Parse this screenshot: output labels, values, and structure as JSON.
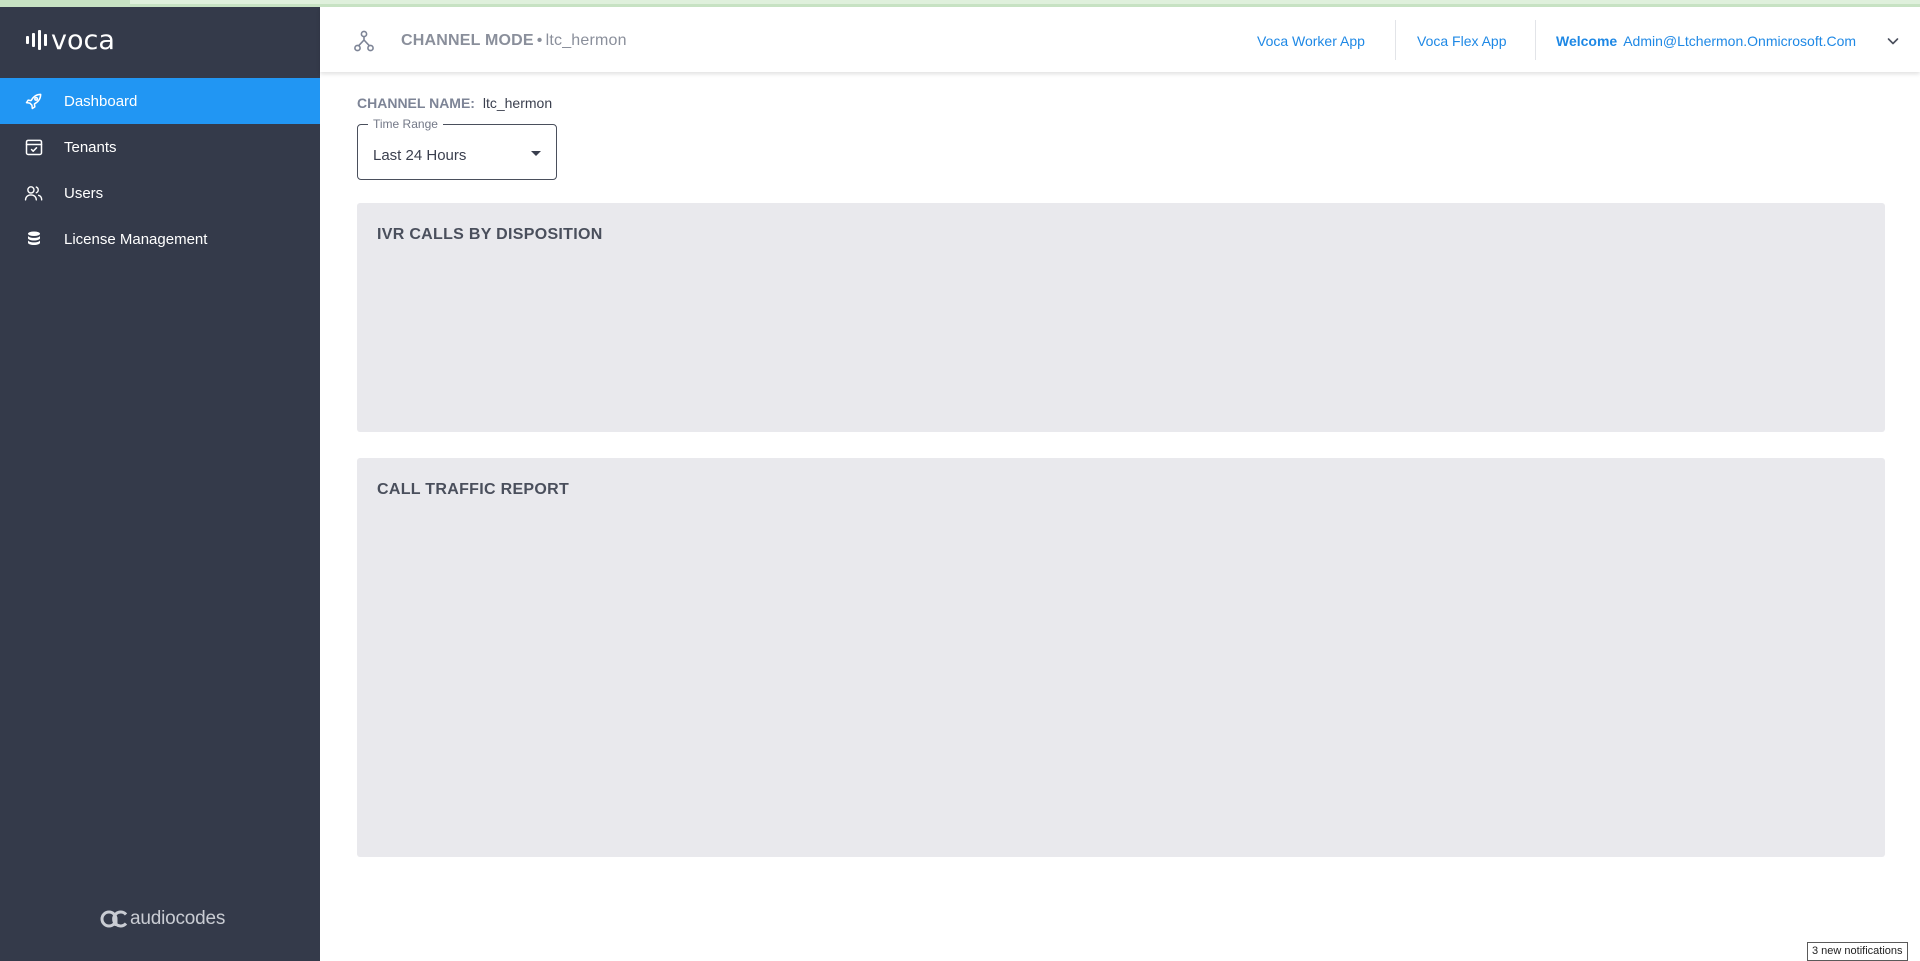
{
  "app": {
    "logo_text": "voca",
    "brand": "audiocodes"
  },
  "sidebar": {
    "items": [
      {
        "label": "Dashboard",
        "icon": "rocket-icon",
        "active": true
      },
      {
        "label": "Tenants",
        "icon": "calendar-check-icon",
        "active": false
      },
      {
        "label": "Users",
        "icon": "users-icon",
        "active": false
      },
      {
        "label": "License Management",
        "icon": "database-icon",
        "active": false
      }
    ]
  },
  "header": {
    "mode_label": "CHANNEL MODE",
    "mode_value": "ltc_hermon",
    "links": {
      "worker_app": "Voca Worker App",
      "flex_app": "Voca Flex App"
    },
    "welcome_label": "Welcome",
    "user_email": "Admin@Ltchermon.Onmicrosoft.Com"
  },
  "main": {
    "channel_name_label": "CHANNEL NAME:",
    "channel_name_value": "ltc_hermon",
    "time_range": {
      "legend": "Time Range",
      "value": "Last 24 Hours"
    },
    "panels": [
      {
        "title": "IVR CALLS BY DISPOSITION"
      },
      {
        "title": "CALL TRAFFIC REPORT"
      }
    ]
  },
  "notifications": {
    "text": "3 new notifications"
  },
  "colors": {
    "sidebar_bg": "#343a4a",
    "accent": "#2196f3",
    "link": "#1e88e5",
    "panel_bg": "#e9e9ed"
  }
}
